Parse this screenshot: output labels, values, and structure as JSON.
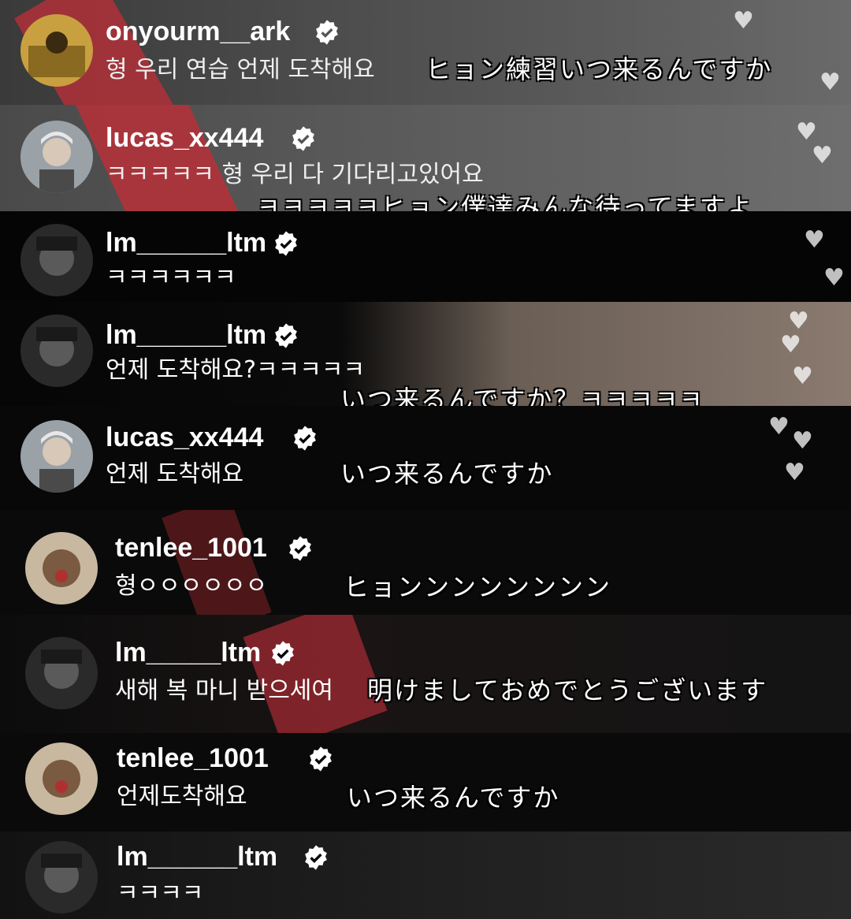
{
  "comments": [
    {
      "username": "onyourm__ark",
      "message": "형 우리 연습 언제 도착해요",
      "translation": "ヒョン練習いつ来るんですか"
    },
    {
      "username": "lucas_xx444",
      "message": "ㅋㅋㅋㅋㅋ 형 우리 다 기다리고있어요",
      "translation": "ㅋㅋㅋㅋㅋヒョン僕達みんな待ってますよ"
    },
    {
      "username": "lm______ltm",
      "message": "ㅋㅋㅋㅋㅋㅋ",
      "translation": ""
    },
    {
      "username": "lm______ltm",
      "message": "언제 도착해요?ㅋㅋㅋㅋㅋ",
      "translation": "いつ来るんですか？ㅋㅋㅋㅋㅋ"
    },
    {
      "username": "lucas_xx444",
      "message": "언제 도착해요",
      "translation": "いつ来るんですか"
    },
    {
      "username": "tenlee_1001",
      "message": "형ㅇㅇㅇㅇㅇㅇ",
      "translation": "ヒョンンンンンンンン"
    },
    {
      "username": "lm_____ltm",
      "message": "새해 복 마니 받으세여",
      "translation": "明けましておめでとうございます"
    },
    {
      "username": "tenlee_1001",
      "message": "언제도착해요",
      "translation": "いつ来るんですか"
    },
    {
      "username": "lm______ltm",
      "message": "ㅋㅋㅋㅋ",
      "translation": ""
    }
  ],
  "icons": {
    "verified": "verified-badge-icon",
    "heart": "heart-icon"
  },
  "colors": {
    "verified": "#ffffff",
    "text": "#ffffff",
    "background": "#000000",
    "accent_red": "#c0343c"
  }
}
